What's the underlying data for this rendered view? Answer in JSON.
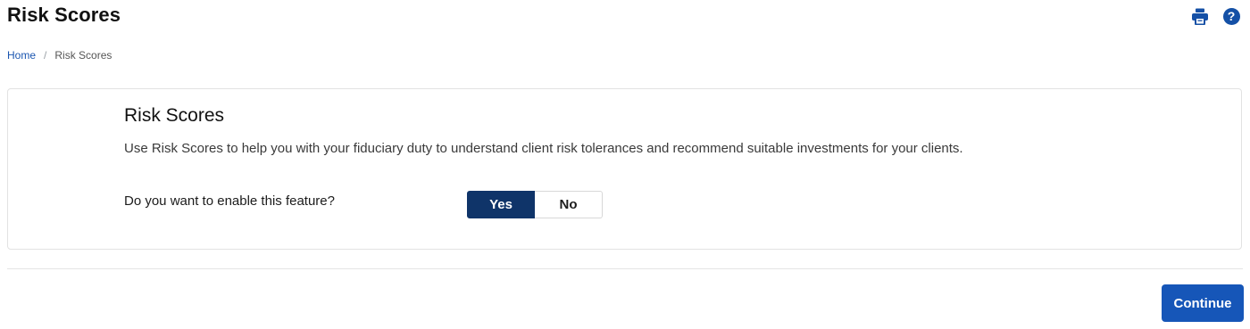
{
  "page": {
    "title": "Risk Scores"
  },
  "header_icons": [
    {
      "name": "print-icon",
      "color": "#1450a6"
    },
    {
      "name": "help-icon",
      "glyph": "?",
      "color": "#1450a6"
    }
  ],
  "breadcrumb": {
    "items": [
      "Home",
      "Risk Scores"
    ],
    "separator": "/"
  },
  "card": {
    "title": "Risk Scores",
    "description": "Use Risk Scores to help you with your fiduciary duty to understand client risk tolerances and recommend suitable investments for your clients.",
    "question": "Do you want to enable this feature?",
    "toggle": {
      "options": [
        "Yes",
        "No"
      ],
      "selected": "Yes",
      "selected_color": "#0f3469"
    }
  },
  "footer": {
    "continue_label": "Continue",
    "continue_color": "#1656b8"
  }
}
